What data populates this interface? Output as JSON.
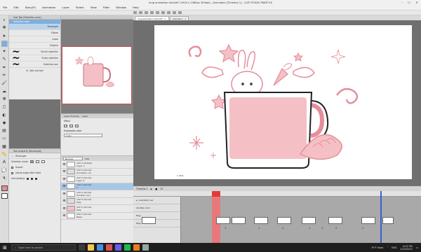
{
  "window": {
    "title": "mug animation tutorial* (1920 x 1080px 300dpi) - Animation [Timeline 1] - CLIP STUDIO PAINT EX"
  },
  "menu": [
    "File",
    "Edit",
    "Story(P)",
    "Animation",
    "Layer",
    "Select",
    "View",
    "Filter",
    "Window",
    "Help"
  ],
  "tabs": {
    "doc1": "mug animation tutorial*",
    "doc2": "Animation"
  },
  "subtool": {
    "panel_title": "Sub Tool [Selection area]",
    "tab": "Selection area",
    "items": [
      "Rectangle",
      "Ellipse",
      "Lasso",
      "Polyline",
      "Shrink selection",
      "Erase selection",
      "Selection pen"
    ],
    "add_label": "Add sub tool"
  },
  "toolprop": {
    "title": "Tool property [Rectangle]",
    "tool_name": "Rectangle",
    "rows": [
      "Selection mode",
      "Aspect",
      "Adjust angle after fixed",
      "Anti-aliasing"
    ]
  },
  "layerprop": {
    "tab1": "Layer Property",
    "tab2": "Layer",
    "effect_label": "Effect",
    "expression_label": "Expression color",
    "expression_value": "Color",
    "blend_value": "Normal"
  },
  "layers": {
    "blend": "Normal",
    "opacity": "100",
    "rows": [
      {
        "pct": "100 % Multiply",
        "name": "Layer 2"
      },
      {
        "pct": "100 % Normal",
        "name": "Animation cel"
      },
      {
        "pct": "100 % Normal",
        "name": "Layer 6"
      },
      {
        "pct": "100 % Normal",
        "name": "1"
      },
      {
        "pct": "100 % Normal",
        "name": "doodles color"
      },
      {
        "pct": "100 % Normal",
        "name": "Mug"
      },
      {
        "pct": "100 % Normal",
        "name": "Mug"
      },
      {
        "pct": "100 % Normal",
        "name": "Paper"
      }
    ]
  },
  "canvas": {
    "zoom": "1 dtim"
  },
  "timeline": {
    "title": "Timeline 1",
    "frame": "13",
    "rows": [
      "Animation cel",
      "doodles color",
      "Mug",
      "Mug"
    ],
    "cel_numbers": [
      "1",
      "1",
      "2",
      "1",
      "1",
      "2",
      "1"
    ]
  },
  "taskbar": {
    "search_placeholder": "Type here to search",
    "weather": "79°F Haze",
    "lang": "ENG",
    "time": "4:02 PM",
    "date": "2/22/2022"
  },
  "colors": {
    "mug_pink": "#f4c0c6",
    "line_pink": "#e58e9a",
    "selection_blue": "#7db0da",
    "playhead": "#e23b3b"
  }
}
